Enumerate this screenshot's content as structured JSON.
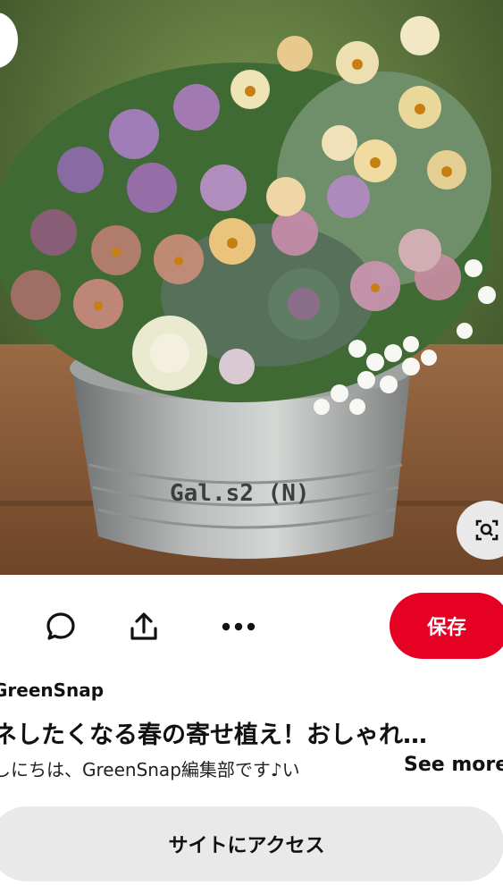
{
  "pin": {
    "image_alt_text": "Gal.s2 (N)",
    "source_name": "GreenSnap",
    "title": "ネしたくなる春の寄せ植え！おしゃれ…",
    "description": "しにちは、GreenSnap編集部です♪い",
    "see_more_label": "See more"
  },
  "actions": {
    "comment_icon": "comment-icon",
    "share_icon": "share-icon",
    "more_icon": "more-icon",
    "save_label": "保存"
  },
  "visit_button_label": "サイトにアクセス",
  "colors": {
    "save_button": "#e60023",
    "visit_button_bg": "#e9e9e9"
  }
}
